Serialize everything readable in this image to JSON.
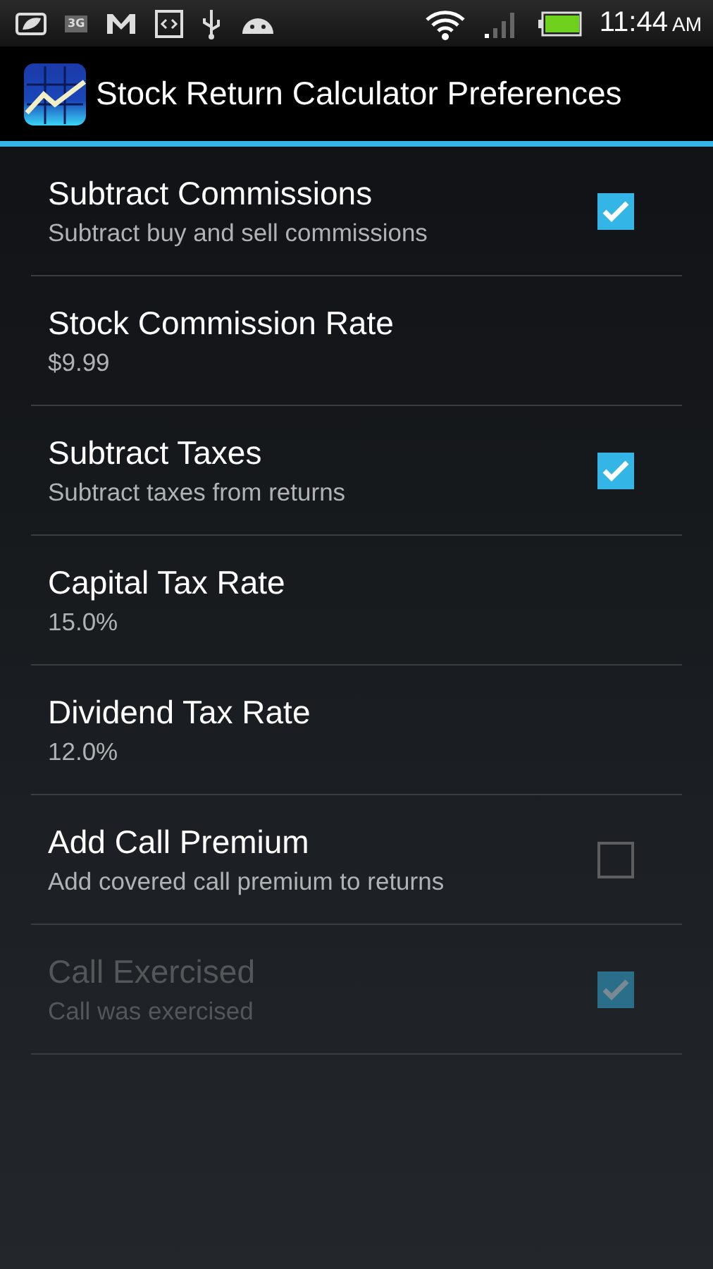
{
  "status_bar": {
    "network_label": "3G",
    "time": "11:44",
    "meridiem": "AM"
  },
  "action_bar": {
    "title": "Stock Return Calculator Preferences"
  },
  "preferences": [
    {
      "kind": "checkbox",
      "title": "Subtract Commissions",
      "summary": "Subtract buy and sell commissions",
      "checked": true,
      "disabled": false
    },
    {
      "kind": "text",
      "title": "Stock Commission Rate",
      "summary": "$9.99",
      "disabled": false
    },
    {
      "kind": "checkbox",
      "title": "Subtract Taxes",
      "summary": "Subtract taxes from returns",
      "checked": true,
      "disabled": false
    },
    {
      "kind": "text",
      "title": "Capital Tax Rate",
      "summary": "15.0%",
      "disabled": false
    },
    {
      "kind": "text",
      "title": "Dividend Tax Rate",
      "summary": "12.0%",
      "disabled": false
    },
    {
      "kind": "checkbox",
      "title": "Add Call Premium",
      "summary": "Add covered call premium to returns",
      "checked": false,
      "disabled": false
    },
    {
      "kind": "checkbox",
      "title": "Call Exercised",
      "summary": "Call was exercised",
      "checked": true,
      "disabled": true
    }
  ]
}
